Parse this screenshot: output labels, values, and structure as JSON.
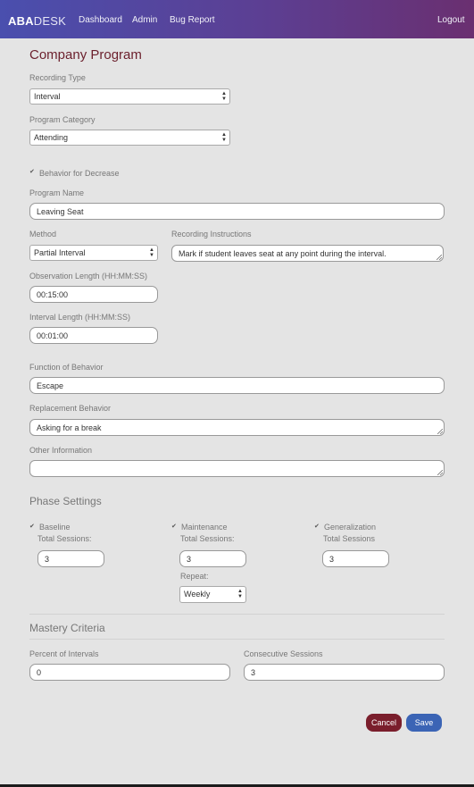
{
  "navbar": {
    "brand_bold": "ABA",
    "brand_thin": "DESK",
    "links": [
      "Dashboard",
      "Admin",
      "Bug Report"
    ],
    "logout": "Logout"
  },
  "page_title": "Company Program",
  "recording_type": {
    "label": "Recording Type",
    "value": "Interval"
  },
  "program_category": {
    "label": "Program Category",
    "value": "Attending"
  },
  "behavior_for_decrease": {
    "label": "Behavior for Decrease",
    "checked": true
  },
  "program_name": {
    "label": "Program Name",
    "value": "Leaving Seat"
  },
  "method": {
    "label": "Method",
    "value": "Partial Interval"
  },
  "recording_instructions": {
    "label": "Recording Instructions",
    "value": "Mark if student leaves seat at any point during the interval."
  },
  "observation_length": {
    "label": "Observation Length (HH:MM:SS)",
    "value": "00:15:00"
  },
  "interval_length": {
    "label": "Interval Length (HH:MM:SS)",
    "value": "00:01:00"
  },
  "function_of_behavior": {
    "label": "Function of Behavior",
    "value": "Escape"
  },
  "replacement_behavior": {
    "label": "Replacement Behavior",
    "value": "Asking for a break"
  },
  "other_information": {
    "label": "Other Information",
    "value": ""
  },
  "phase_settings": {
    "title": "Phase Settings",
    "baseline": {
      "label": "Baseline",
      "sessions_label": "Total Sessions:",
      "sessions": "3",
      "checked": true
    },
    "maintenance": {
      "label": "Maintenance",
      "sessions_label": "Total Sessions:",
      "sessions": "3",
      "repeat_label": "Repeat:",
      "repeat": "Weekly",
      "checked": true
    },
    "generalization": {
      "label": "Generalization",
      "sessions_label": "Total Sessions",
      "sessions": "3",
      "checked": true
    }
  },
  "mastery_criteria": {
    "title": "Mastery Criteria",
    "percent_label": "Percent of Intervals",
    "percent_value": "0",
    "consecutive_label": "Consecutive Sessions",
    "consecutive_value": "3"
  },
  "buttons": {
    "cancel": "Cancel",
    "save": "Save"
  },
  "colors": {
    "cancel": "#7a1e2c",
    "save": "#3b64b5",
    "title": "#6b1f2c",
    "nav_start": "#4a4fae",
    "nav_end": "#6a2f70"
  }
}
